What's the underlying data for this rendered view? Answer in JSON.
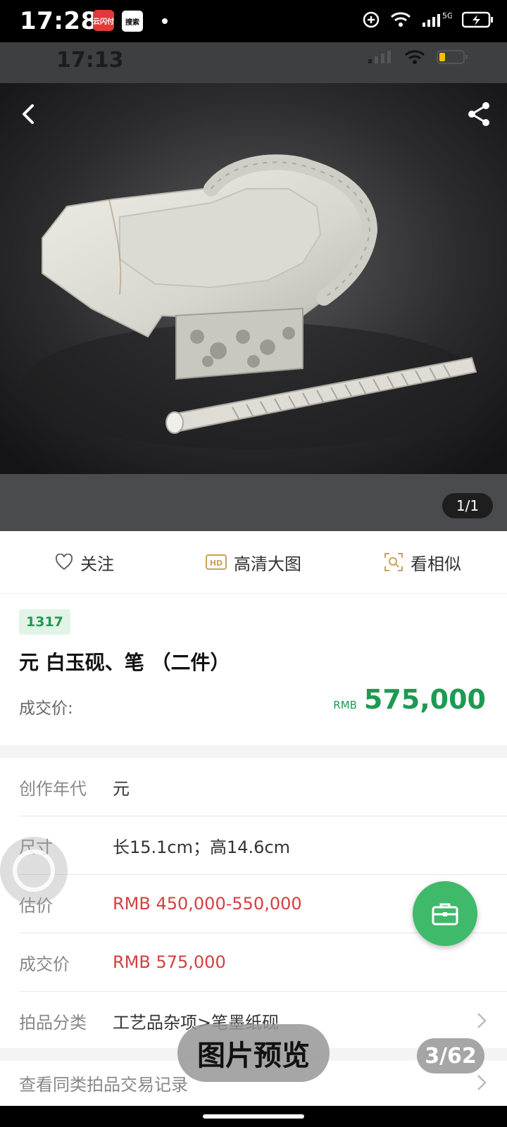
{
  "status_bar": {
    "time": "17:28",
    "app_badge_red": "云闪付",
    "app_badge_search": "搜索",
    "network": "5G"
  },
  "inner_status_bar": {
    "time": "17:13"
  },
  "image_viewer": {
    "counter": "1/1"
  },
  "actions": {
    "follow": "关注",
    "hd_image": "高清大图",
    "hd_badge": "HD",
    "similar": "看相似"
  },
  "lot": {
    "number": "1317",
    "title": "元 白玉砚、笔 （二件）",
    "deal_label": "成交价:",
    "deal_currency": "RMB",
    "deal_amount": "575,000"
  },
  "details": [
    {
      "label": "创作年代",
      "value": "元"
    },
    {
      "label": "尺寸",
      "value": "长15.1cm；高14.6cm"
    },
    {
      "label": "估价",
      "value": "RMB  450,000-550,000"
    },
    {
      "label": "成交价",
      "value": "RMB 575,000"
    },
    {
      "label": "拍品分类",
      "value": "工艺品杂项>笔墨纸砚"
    }
  ],
  "more_link": "查看同类拍品交易记录",
  "overlay": {
    "preview": "图片预览",
    "page": "3/62"
  },
  "colors": {
    "accent_green": "#3fba6a",
    "price_green": "#1d9a52",
    "price_red": "#d44040"
  }
}
